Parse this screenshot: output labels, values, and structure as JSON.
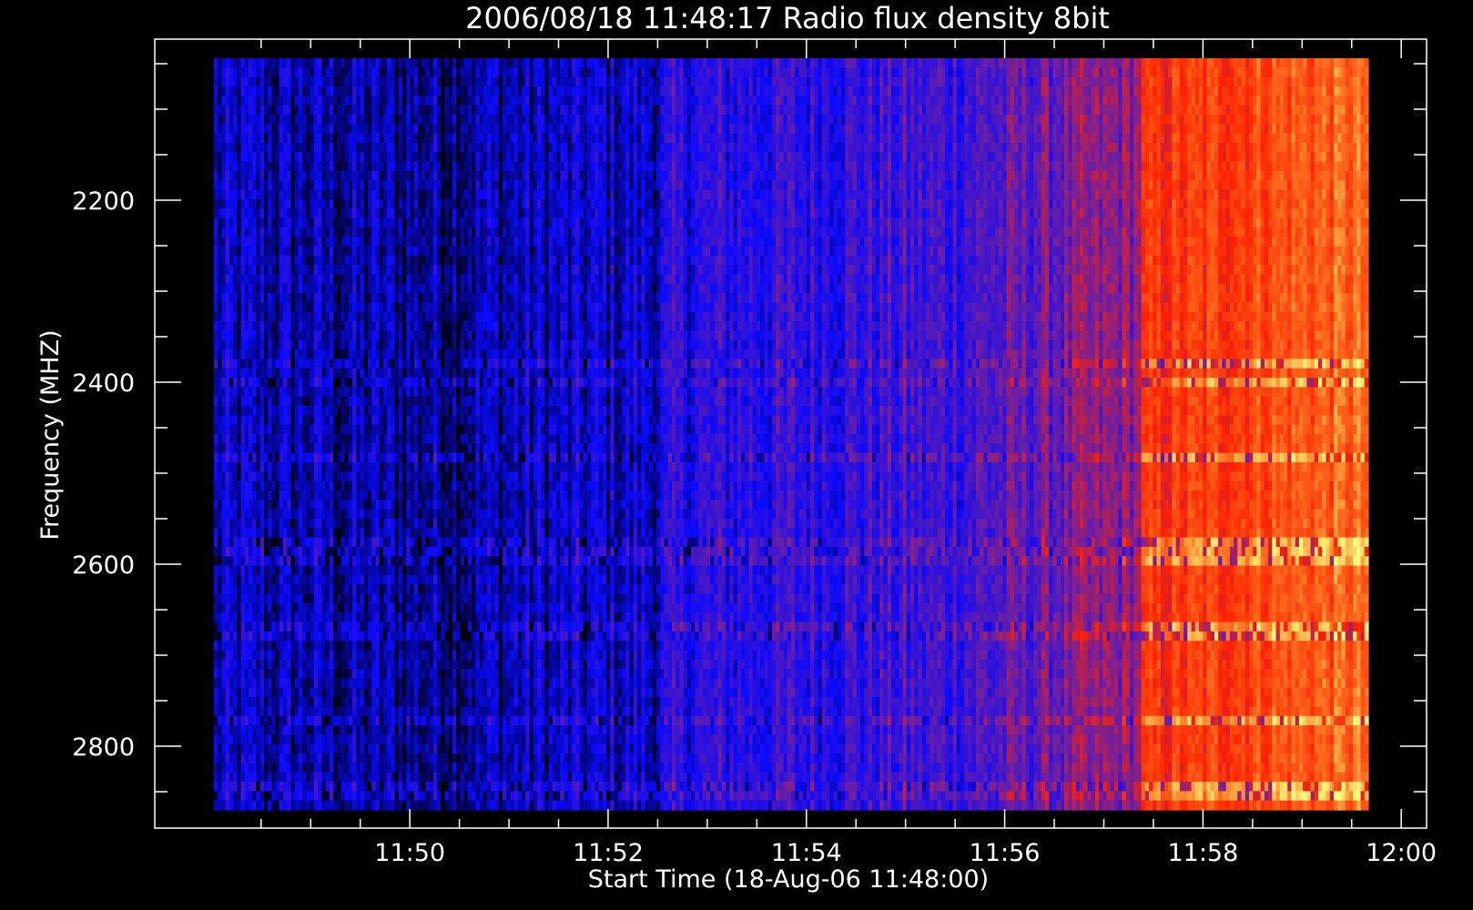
{
  "chart_data": {
    "type": "heatmap",
    "title": "2006/08/18 11:48:17 Radio flux density 8bit",
    "xlabel": "Start Time (18-Aug-06 11:48:00)",
    "ylabel": "Frequency (MHZ)",
    "x_range": [
      "11:48:17",
      "12:00:00"
    ],
    "y_range": [
      2040,
      2860
    ],
    "y_inverted": true,
    "x_ticks": [
      {
        "label": "11:50",
        "minutes": 2
      },
      {
        "label": "11:52",
        "minutes": 4
      },
      {
        "label": "11:54",
        "minutes": 6
      },
      {
        "label": "11:56",
        "minutes": 8
      },
      {
        "label": "11:58",
        "minutes": 10
      },
      {
        "label": "12:00",
        "minutes": 12
      }
    ],
    "y_ticks": [
      2200,
      2400,
      2600,
      2800
    ],
    "colormap": [
      "#000000",
      "#0a0aff",
      "#7020a0",
      "#ff2000",
      "#ff7020",
      "#ffff80"
    ],
    "intensity_trend": [
      {
        "time": "11:48:17",
        "level": 0.14
      },
      {
        "time": "11:50:00",
        "level": 0.12
      },
      {
        "time": "11:52:30",
        "level": 0.17
      },
      {
        "time": "11:52:40",
        "level": 0.24
      },
      {
        "time": "11:54:00",
        "level": 0.27
      },
      {
        "time": "11:55:30",
        "level": 0.3
      },
      {
        "time": "11:56:30",
        "level": 0.38
      },
      {
        "time": "11:57:20",
        "level": 0.44
      },
      {
        "time": "11:57:25",
        "level": 0.62
      },
      {
        "time": "11:58:00",
        "level": 0.66
      },
      {
        "time": "11:59:00",
        "level": 0.74
      },
      {
        "time": "12:00:00",
        "level": 0.78
      }
    ],
    "horizontal_bands_mhz": [
      2380,
      2400,
      2480,
      2575,
      2590,
      2675,
      2770,
      2850
    ],
    "grid": false,
    "legend": "none"
  }
}
